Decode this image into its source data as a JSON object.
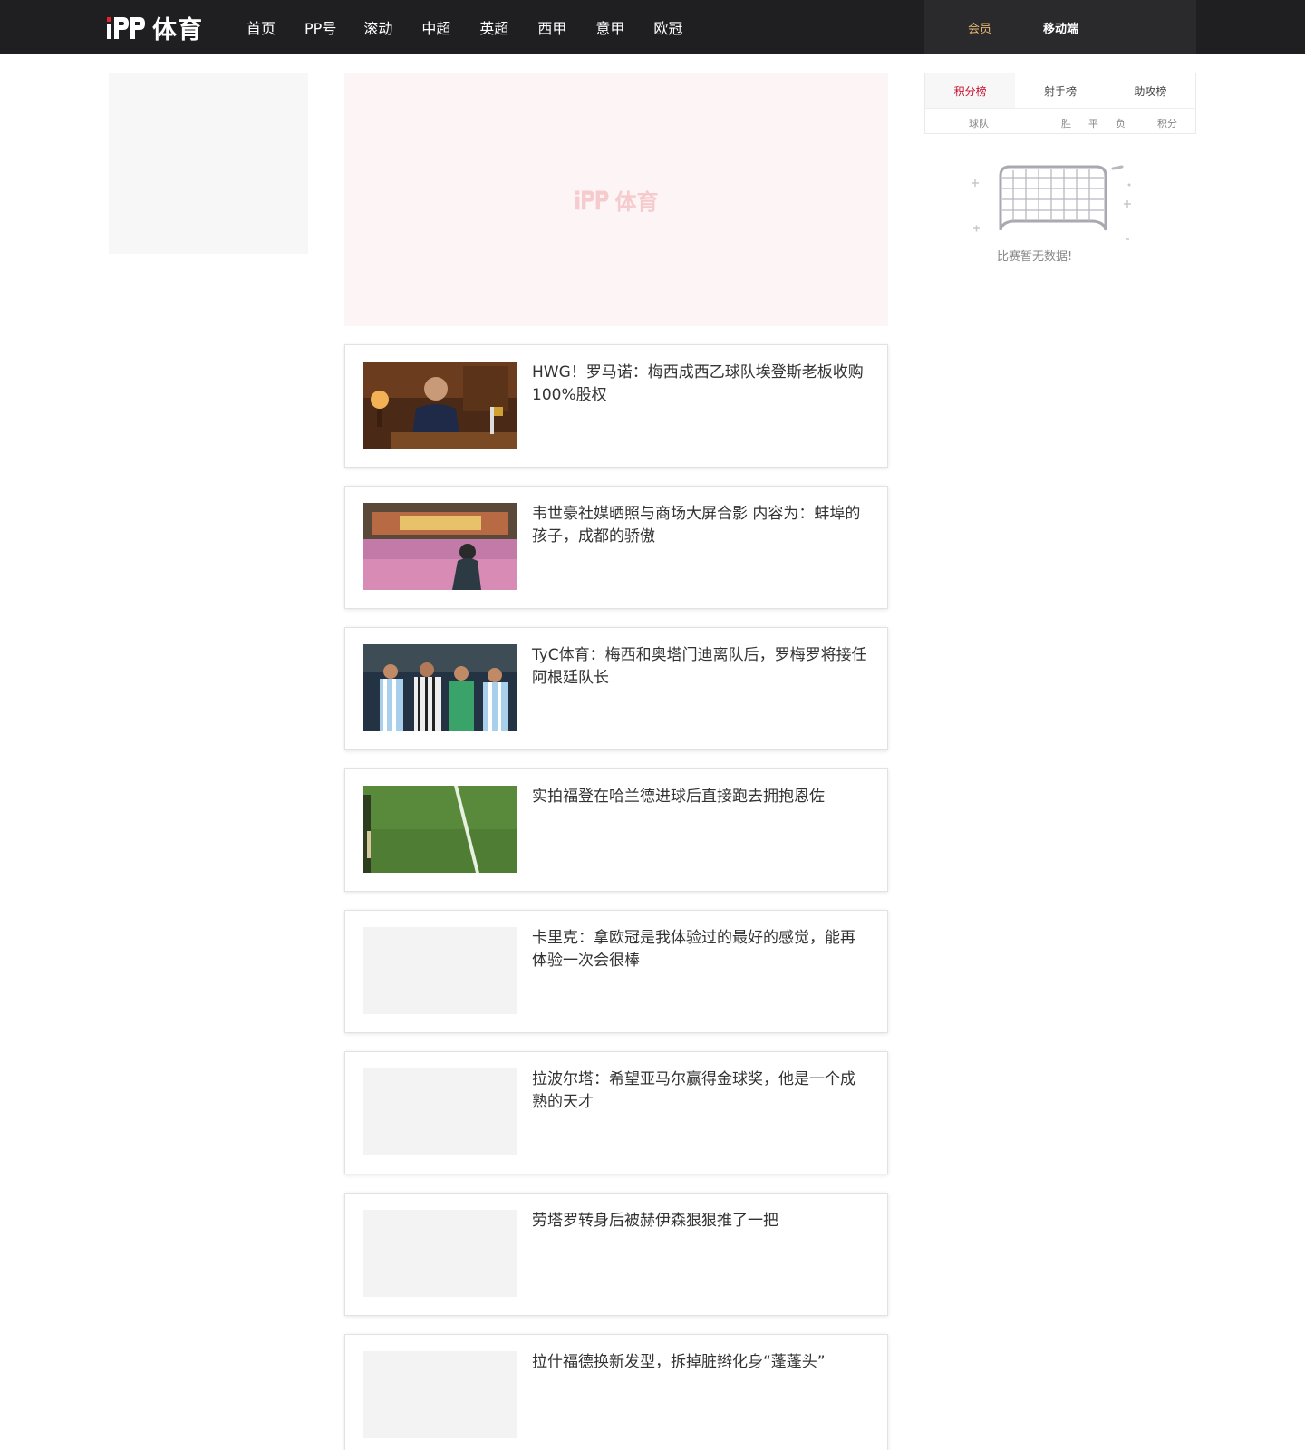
{
  "header": {
    "logo_text": "体育",
    "nav": [
      "首页",
      "PP号",
      "滚动",
      "中超",
      "英超",
      "西甲",
      "意甲",
      "欧冠"
    ],
    "member_label": "会员",
    "mobile_label": "移动端",
    "member_color": "#e6b872"
  },
  "banner": {
    "logo_text": "体育"
  },
  "news": [
    {
      "title": "HWG！罗马诺：梅西成西乙球队埃登斯老板收购100%股权",
      "thumb": "office-icon"
    },
    {
      "title": "韦世豪社媒晒照与商场大屏合影 内容为：蚌埠的孩子，成都的骄傲",
      "thumb": "mall-icon"
    },
    {
      "title": "TyC体育：梅西和奥塔门迪离队后，罗梅罗将接任阿根廷队长",
      "thumb": "team-icon"
    },
    {
      "title": "实拍福登在哈兰德进球后直接跑去拥抱恩佐",
      "thumb": "pitch-icon"
    },
    {
      "title": "卡里克：拿欧冠是我体验过的最好的感觉，能再体验一次会很棒",
      "thumb": ""
    },
    {
      "title": "拉波尔塔：希望亚马尔赢得金球奖，他是一个成熟的天才",
      "thumb": ""
    },
    {
      "title": "劳塔罗转身后被赫伊森狠狠推了一把",
      "thumb": ""
    },
    {
      "title": "拉什福德换新发型，拆掉脏辫化身“蓬蓬头”",
      "thumb": ""
    }
  ],
  "rank": {
    "tabs": [
      "积分榜",
      "射手榜",
      "助攻榜"
    ],
    "active_tab": "积分榜",
    "columns": {
      "team": "球队",
      "win": "胜",
      "draw": "平",
      "loss": "负",
      "points": "积分"
    },
    "empty_text": "比赛暂无数据!"
  }
}
